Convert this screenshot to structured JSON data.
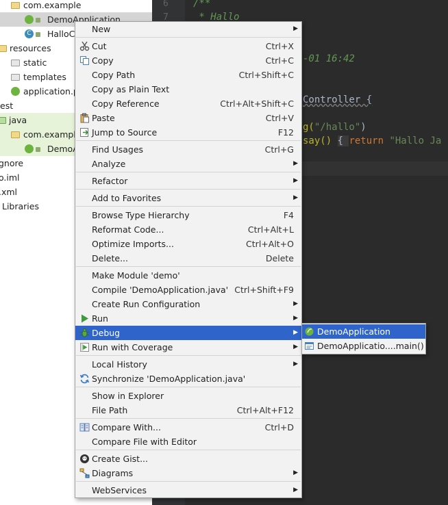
{
  "tree": {
    "items": [
      {
        "label": "com.example",
        "icon": "folder-icon"
      },
      {
        "label": "DemoApplication",
        "icon": "spring-class-icon"
      },
      {
        "label": "HalloCo",
        "icon": "class-icon"
      },
      {
        "label": "resources",
        "icon": "folder-icon"
      },
      {
        "label": "static",
        "icon": "folder-icon"
      },
      {
        "label": "templates",
        "icon": "folder-icon"
      },
      {
        "label": "application.p",
        "icon": "spring-config-icon"
      },
      {
        "label": "est",
        "icon": ""
      },
      {
        "label": "java",
        "icon": "folder-icon"
      },
      {
        "label": "com.example",
        "icon": "folder-icon"
      },
      {
        "label": "DemoA",
        "icon": "spring-class-icon"
      },
      {
        "label": "gnore",
        "icon": ""
      },
      {
        "label": "o.iml",
        "icon": ""
      },
      {
        "label": ".xml",
        "icon": ""
      },
      {
        "label": "Libraries",
        "icon": ""
      }
    ]
  },
  "editor": {
    "line_numbers": [
      "6",
      "7"
    ],
    "code": {
      "l1": "/**",
      "l2": " * Hallo",
      "date": "-01 16:42",
      "controller": "Controller {",
      "mapping_a": "g(",
      "mapping_b": "\"/hallo\"",
      "mapping_c": ")",
      "say_a": "say() ",
      "say_brace": "{ ",
      "say_return": "return ",
      "say_str": "\"Hallo Ja"
    }
  },
  "context_menu": {
    "items": [
      {
        "label": "New",
        "shortcut": "",
        "submenu": true
      },
      {
        "label": "Cut",
        "shortcut": "Ctrl+X"
      },
      {
        "label": "Copy",
        "shortcut": "Ctrl+C"
      },
      {
        "label": "Copy Path",
        "shortcut": "Ctrl+Shift+C"
      },
      {
        "label": "Copy as Plain Text",
        "shortcut": ""
      },
      {
        "label": "Copy Reference",
        "shortcut": "Ctrl+Alt+Shift+C"
      },
      {
        "label": "Paste",
        "shortcut": "Ctrl+V"
      },
      {
        "label": "Jump to Source",
        "shortcut": "F12"
      },
      {
        "label": "Find Usages",
        "shortcut": "Ctrl+G"
      },
      {
        "label": "Analyze",
        "shortcut": "",
        "submenu": true
      },
      {
        "label": "Refactor",
        "shortcut": "",
        "submenu": true
      },
      {
        "label": "Add to Favorites",
        "shortcut": "",
        "submenu": true
      },
      {
        "label": "Browse Type Hierarchy",
        "shortcut": "F4"
      },
      {
        "label": "Reformat Code...",
        "shortcut": "Ctrl+Alt+L"
      },
      {
        "label": "Optimize Imports...",
        "shortcut": "Ctrl+Alt+O"
      },
      {
        "label": "Delete...",
        "shortcut": "Delete"
      },
      {
        "label": "Make Module 'demo'",
        "shortcut": ""
      },
      {
        "label": "Compile 'DemoApplication.java'",
        "shortcut": "Ctrl+Shift+F9"
      },
      {
        "label": "Create Run Configuration",
        "shortcut": "",
        "submenu": true
      },
      {
        "label": "Run",
        "shortcut": "",
        "submenu": true
      },
      {
        "label": "Debug",
        "shortcut": "",
        "submenu": true,
        "highlighted": true
      },
      {
        "label": "Run with Coverage",
        "shortcut": "",
        "submenu": true
      },
      {
        "label": "Local History",
        "shortcut": "",
        "submenu": true
      },
      {
        "label": "Synchronize 'DemoApplication.java'",
        "shortcut": ""
      },
      {
        "label": "Show in Explorer",
        "shortcut": ""
      },
      {
        "label": "File Path",
        "shortcut": "Ctrl+Alt+F12"
      },
      {
        "label": "Compare With...",
        "shortcut": "Ctrl+D"
      },
      {
        "label": "Compare File with Editor",
        "shortcut": ""
      },
      {
        "label": "Create Gist...",
        "shortcut": ""
      },
      {
        "label": "Diagrams",
        "shortcut": "",
        "submenu": true
      },
      {
        "label": "WebServices",
        "shortcut": "",
        "submenu": true
      }
    ]
  },
  "submenu": {
    "items": [
      {
        "label": "DemoApplication",
        "highlighted": true
      },
      {
        "label": "DemoApplicatio....main()"
      }
    ]
  },
  "colors": {
    "highlight": "#2f65ca",
    "editor_bg": "#2b2b2b",
    "menu_bg": "#f2f2f2"
  }
}
